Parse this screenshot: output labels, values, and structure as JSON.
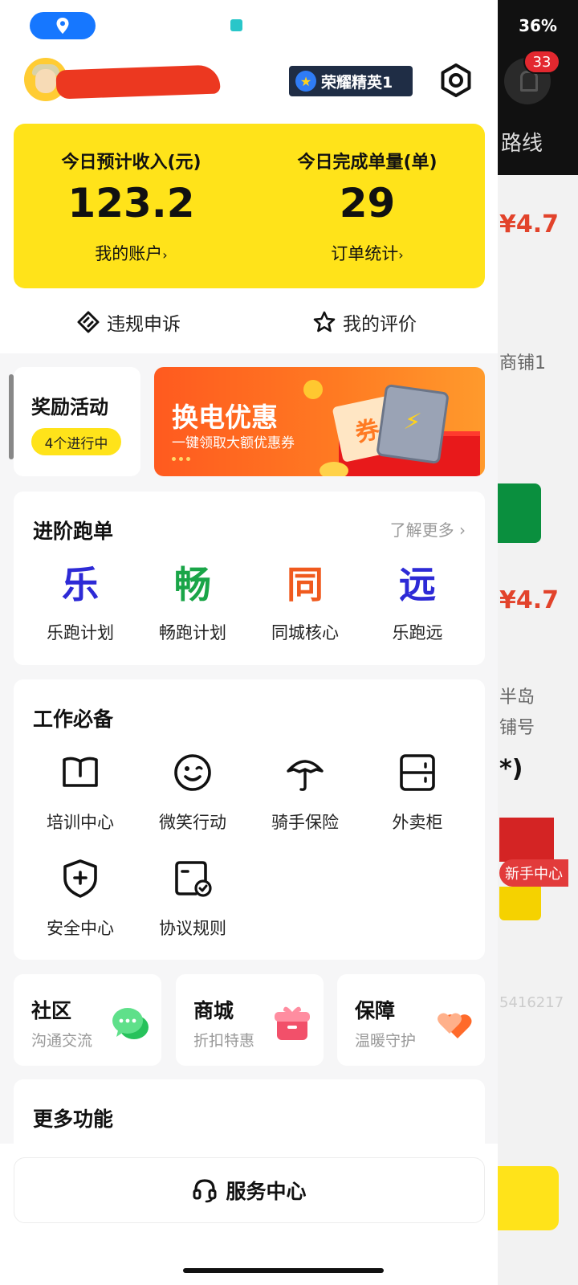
{
  "status_bar": {
    "battery": "36%"
  },
  "header": {
    "rank_badge": "荣耀精英1"
  },
  "earnings": {
    "income_label": "今日预计收入(元)",
    "income_value": "123.2",
    "account_link": "我的账户",
    "orders_label": "今日完成单量(单)",
    "orders_value": "29",
    "orders_link": "订单统计"
  },
  "quick_actions": {
    "appeal": "违规申诉",
    "my_rating": "我的评价"
  },
  "rewards": {
    "title": "奖励活动",
    "status": "4个进行中"
  },
  "banner": {
    "title": "换电优惠",
    "subtitle": "一键领取大额优惠券",
    "coupon_char": "券"
  },
  "advanced": {
    "title": "进阶跑单",
    "more": "了解更多",
    "items": [
      {
        "char": "乐",
        "label": "乐跑计划",
        "color": "#2d2ad6"
      },
      {
        "char": "畅",
        "label": "畅跑计划",
        "color": "#1aa548"
      },
      {
        "char": "同",
        "label": "同城核心",
        "color": "#f05a1e"
      },
      {
        "char": "远",
        "label": "乐跑远",
        "color": "#2d2ad6"
      }
    ]
  },
  "essentials": {
    "title": "工作必备",
    "items": [
      {
        "label": "培训中心",
        "icon": "book-icon"
      },
      {
        "label": "微笑行动",
        "icon": "smile-icon"
      },
      {
        "label": "骑手保险",
        "icon": "umbrella-icon"
      },
      {
        "label": "外卖柜",
        "icon": "locker-icon"
      },
      {
        "label": "安全中心",
        "icon": "shield-plus-icon"
      },
      {
        "label": "协议规则",
        "icon": "document-check-icon"
      }
    ]
  },
  "mini_cards": [
    {
      "title": "社区",
      "subtitle": "沟通交流",
      "icon": "chat-bubbles-icon"
    },
    {
      "title": "商城",
      "subtitle": "折扣特惠",
      "icon": "gift-box-icon"
    },
    {
      "title": "保障",
      "subtitle": "温暖守护",
      "icon": "hearts-icon"
    }
  ],
  "more": {
    "title": "更多功能"
  },
  "service_center": "服务中心",
  "background_app": {
    "notification_count": "33",
    "route_label": "路线",
    "price_1": "¥4.7",
    "shop_text": "商铺1",
    "price_2": "¥4.7",
    "addr_1": "半岛",
    "addr_2": "铺号",
    "paren": "*)",
    "newbie": "新手中心",
    "number_fragment": "5416217"
  }
}
